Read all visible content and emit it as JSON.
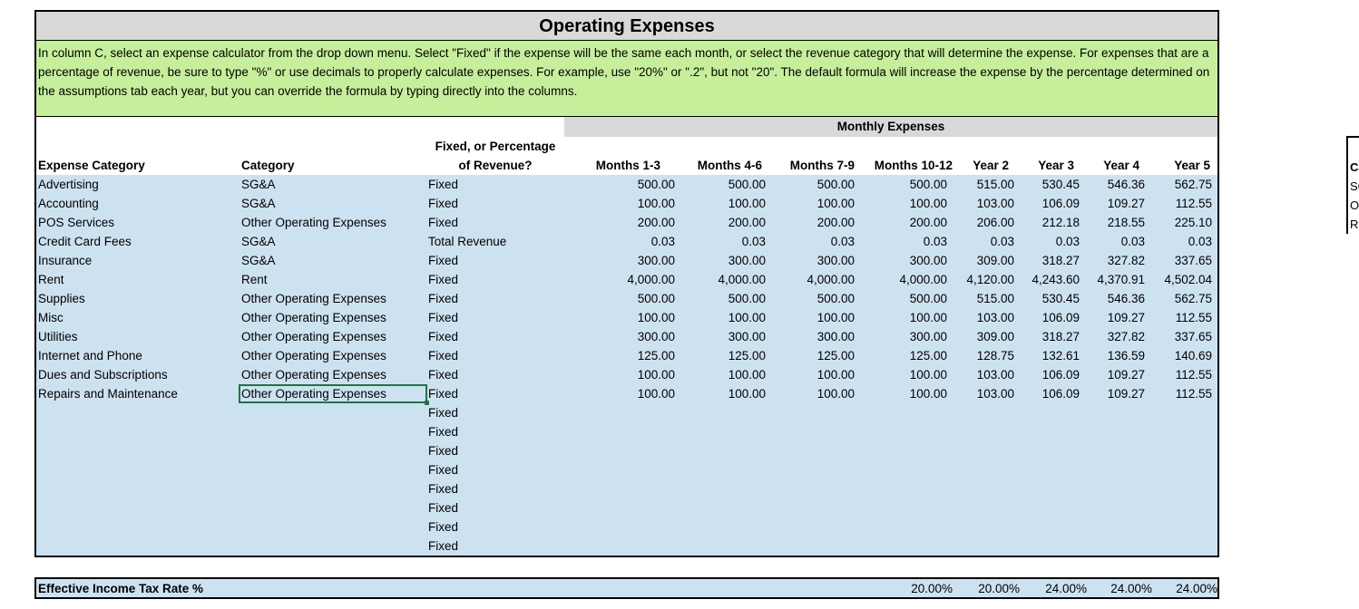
{
  "title": "Operating Expenses",
  "instructions": "In column C, select an expense calculator from the drop down menu. Select \"Fixed\" if the expense will be the same each month, or select the revenue category that will determine the expense. For expenses that are a percentage of revenue, be sure to type \"%\" or use decimals to properly calculate expenses. For example, use \"20%\" or \".2\", but not \"20\". The default formula will increase the expense by the percentage determined on the assumptions tab each year, but you can override the formula by typing directly into the columns.",
  "monthly_header": "Monthly Expenses",
  "headers": {
    "expense_category": "Expense Category",
    "category": "Category",
    "fixed_line1": "Fixed, or Percentage",
    "fixed_line2": "of Revenue?",
    "m1": "Months 1-3",
    "m2": "Months 4-6",
    "m3": "Months 7-9",
    "m4": "Months 10-12",
    "y2": "Year 2",
    "y3": "Year 3",
    "y4": "Year 4",
    "y5": "Year 5"
  },
  "rows": [
    {
      "name": "Advertising",
      "category": "SG&A",
      "calc": "Fixed",
      "m1": "500.00",
      "m2": "500.00",
      "m3": "500.00",
      "m4": "500.00",
      "y2": "515.00",
      "y3": "530.45",
      "y4": "546.36",
      "y5": "562.75"
    },
    {
      "name": "Accounting",
      "category": "SG&A",
      "calc": "Fixed",
      "m1": "100.00",
      "m2": "100.00",
      "m3": "100.00",
      "m4": "100.00",
      "y2": "103.00",
      "y3": "106.09",
      "y4": "109.27",
      "y5": "112.55"
    },
    {
      "name": "POS Services",
      "category": "Other Operating Expenses",
      "calc": "Fixed",
      "m1": "200.00",
      "m2": "200.00",
      "m3": "200.00",
      "m4": "200.00",
      "y2": "206.00",
      "y3": "212.18",
      "y4": "218.55",
      "y5": "225.10"
    },
    {
      "name": "Credit Card Fees",
      "category": "SG&A",
      "calc": "Total Revenue",
      "m1": "0.03",
      "m2": "0.03",
      "m3": "0.03",
      "m4": "0.03",
      "y2": "0.03",
      "y3": "0.03",
      "y4": "0.03",
      "y5": "0.03"
    },
    {
      "name": "Insurance",
      "category": "SG&A",
      "calc": "Fixed",
      "m1": "300.00",
      "m2": "300.00",
      "m3": "300.00",
      "m4": "300.00",
      "y2": "309.00",
      "y3": "318.27",
      "y4": "327.82",
      "y5": "337.65"
    },
    {
      "name": "Rent",
      "category": "Rent",
      "calc": "Fixed",
      "m1": "4,000.00",
      "m2": "4,000.00",
      "m3": "4,000.00",
      "m4": "4,000.00",
      "y2": "4,120.00",
      "y3": "4,243.60",
      "y4": "4,370.91",
      "y5": "4,502.04"
    },
    {
      "name": "Supplies",
      "category": "Other Operating Expenses",
      "calc": "Fixed",
      "m1": "500.00",
      "m2": "500.00",
      "m3": "500.00",
      "m4": "500.00",
      "y2": "515.00",
      "y3": "530.45",
      "y4": "546.36",
      "y5": "562.75"
    },
    {
      "name": "Misc",
      "category": "Other Operating Expenses",
      "calc": "Fixed",
      "m1": "100.00",
      "m2": "100.00",
      "m3": "100.00",
      "m4": "100.00",
      "y2": "103.00",
      "y3": "106.09",
      "y4": "109.27",
      "y5": "112.55"
    },
    {
      "name": "Utilities",
      "category": "Other Operating Expenses",
      "calc": "Fixed",
      "m1": "300.00",
      "m2": "300.00",
      "m3": "300.00",
      "m4": "300.00",
      "y2": "309.00",
      "y3": "318.27",
      "y4": "327.82",
      "y5": "337.65"
    },
    {
      "name": "Internet and Phone",
      "category": "Other Operating Expenses",
      "calc": "Fixed",
      "m1": "125.00",
      "m2": "125.00",
      "m3": "125.00",
      "m4": "125.00",
      "y2": "128.75",
      "y3": "132.61",
      "y4": "136.59",
      "y5": "140.69"
    },
    {
      "name": "Dues and Subscriptions",
      "category": "Other Operating Expenses",
      "calc": "Fixed",
      "m1": "100.00",
      "m2": "100.00",
      "m3": "100.00",
      "m4": "100.00",
      "y2": "103.00",
      "y3": "106.09",
      "y4": "109.27",
      "y5": "112.55"
    },
    {
      "name": "Repairs and Maintenance",
      "category": "Other Operating Expenses",
      "calc": "Fixed",
      "m1": "100.00",
      "m2": "100.00",
      "m3": "100.00",
      "m4": "100.00",
      "y2": "103.00",
      "y3": "106.09",
      "y4": "109.27",
      "y5": "112.55"
    },
    {
      "name": "",
      "category": "",
      "calc": "Fixed",
      "m1": "",
      "m2": "",
      "m3": "",
      "m4": "",
      "y2": "",
      "y3": "",
      "y4": "",
      "y5": ""
    },
    {
      "name": "",
      "category": "",
      "calc": "Fixed",
      "m1": "",
      "m2": "",
      "m3": "",
      "m4": "",
      "y2": "",
      "y3": "",
      "y4": "",
      "y5": ""
    },
    {
      "name": "",
      "category": "",
      "calc": "Fixed",
      "m1": "",
      "m2": "",
      "m3": "",
      "m4": "",
      "y2": "",
      "y3": "",
      "y4": "",
      "y5": ""
    },
    {
      "name": "",
      "category": "",
      "calc": "Fixed",
      "m1": "",
      "m2": "",
      "m3": "",
      "m4": "",
      "y2": "",
      "y3": "",
      "y4": "",
      "y5": ""
    },
    {
      "name": "",
      "category": "",
      "calc": "Fixed",
      "m1": "",
      "m2": "",
      "m3": "",
      "m4": "",
      "y2": "",
      "y3": "",
      "y4": "",
      "y5": ""
    },
    {
      "name": "",
      "category": "",
      "calc": "Fixed",
      "m1": "",
      "m2": "",
      "m3": "",
      "m4": "",
      "y2": "",
      "y3": "",
      "y4": "",
      "y5": ""
    },
    {
      "name": "",
      "category": "",
      "calc": "Fixed",
      "m1": "",
      "m2": "",
      "m3": "",
      "m4": "",
      "y2": "",
      "y3": "",
      "y4": "",
      "y5": ""
    },
    {
      "name": "",
      "category": "",
      "calc": "Fixed",
      "m1": "",
      "m2": "",
      "m3": "",
      "m4": "",
      "y2": "",
      "y3": "",
      "y4": "",
      "y5": ""
    }
  ],
  "tax": {
    "label": "Effective Income Tax Rate %",
    "m4": "20.00%",
    "y2": "20.00%",
    "y3": "24.00%",
    "y4": "24.00%",
    "y5": "24.00%"
  },
  "side_panel": [
    "Ca",
    "SG",
    "Ot",
    "Re"
  ],
  "colors": {
    "title_bg": "#d9d9d9",
    "instructions_bg": "#c6ef9c",
    "data_bg": "#cde2f1",
    "selection": "#217346"
  }
}
